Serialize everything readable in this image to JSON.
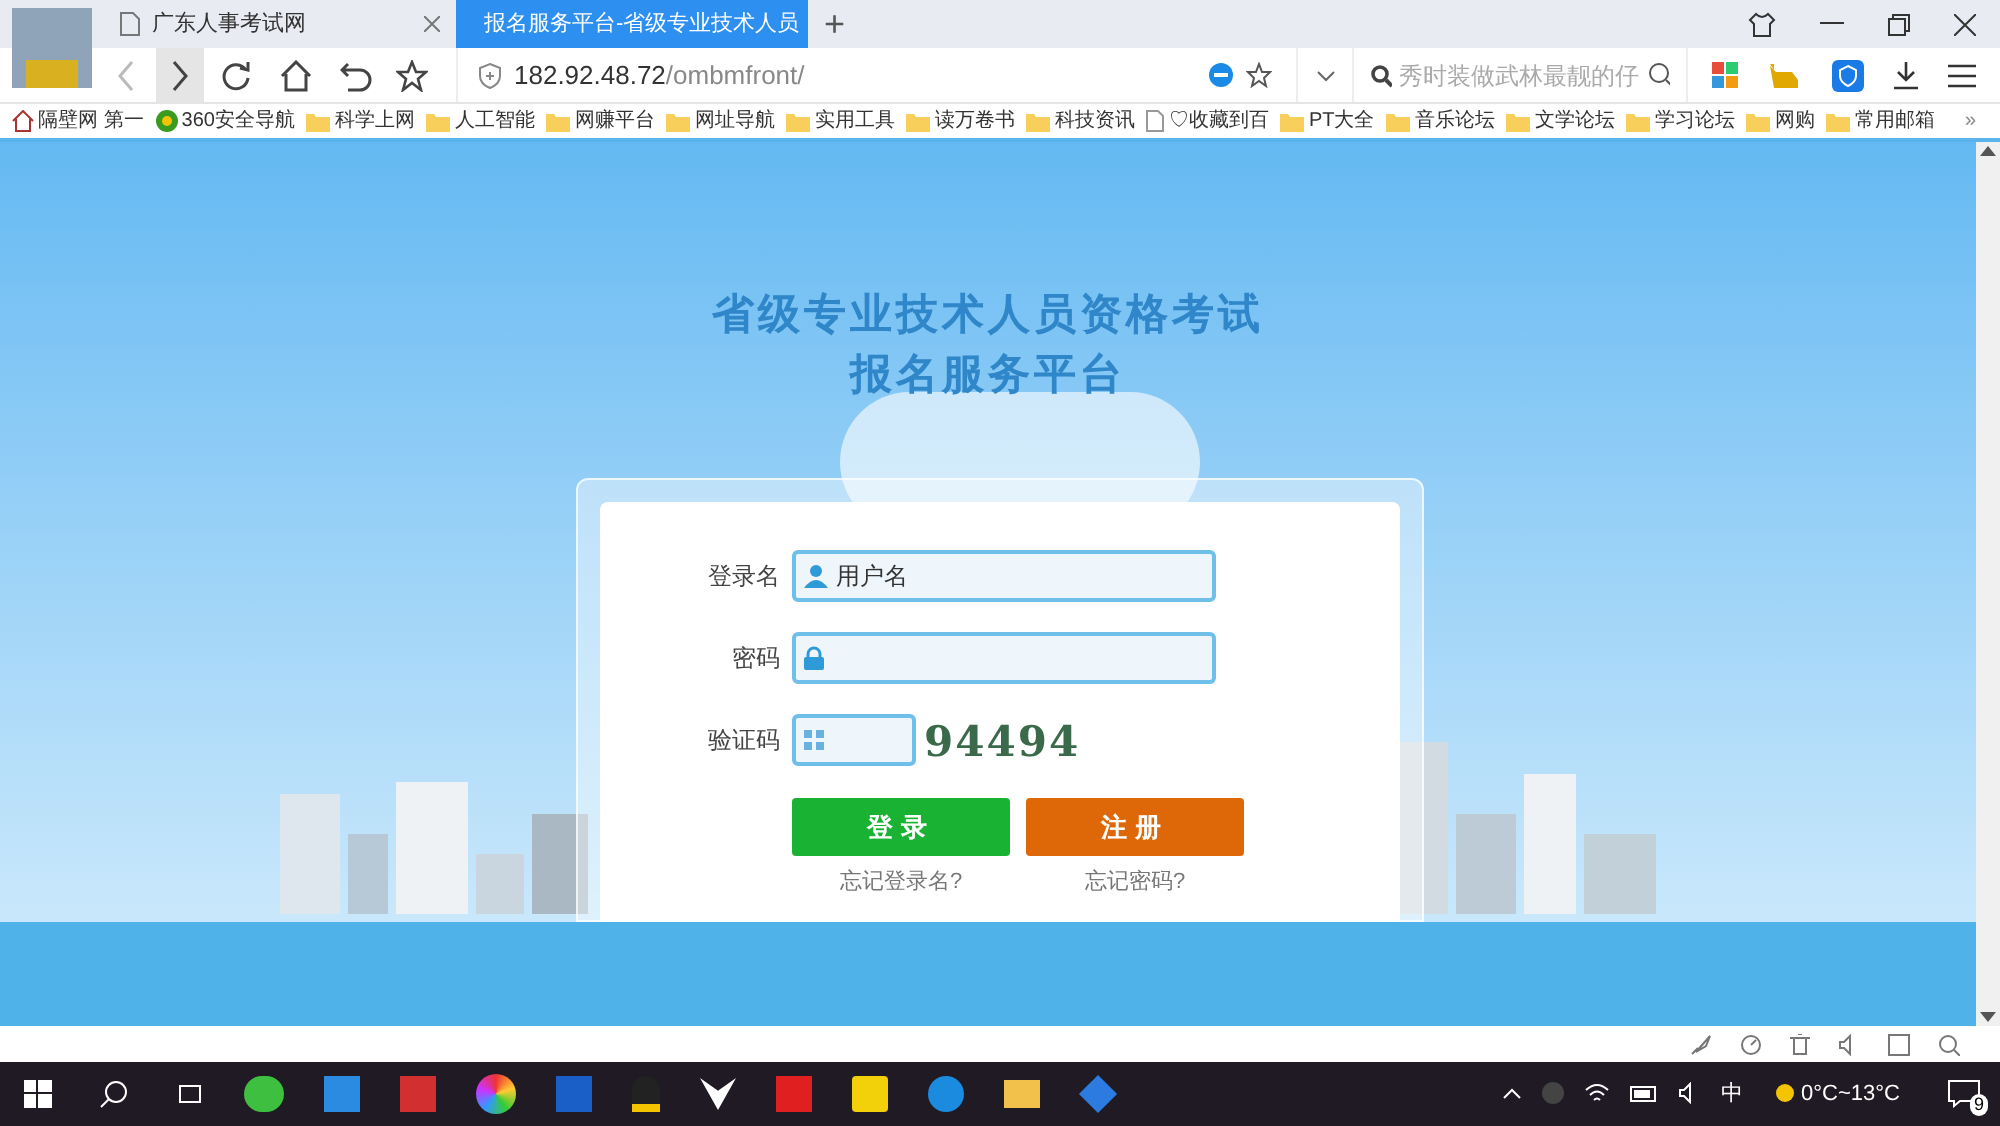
{
  "tabs": [
    {
      "title": "广东人事考试网",
      "selected": false
    },
    {
      "title": "报名服务平台-省级专业技术人员",
      "selected": true
    }
  ],
  "new_tab_button": "+",
  "address_bar": {
    "host": "182.92.48.72",
    "path": "/ombmfront/"
  },
  "search": {
    "placeholder": "秀时装做武林最靓的仔"
  },
  "bookmarks": [
    {
      "label": "隔壁网 第一",
      "kind": "home"
    },
    {
      "label": "360安全导航",
      "kind": "globe"
    },
    {
      "label": "科学上网",
      "kind": "folder"
    },
    {
      "label": "人工智能",
      "kind": "folder"
    },
    {
      "label": "网赚平台",
      "kind": "folder"
    },
    {
      "label": "网址导航",
      "kind": "folder"
    },
    {
      "label": "实用工具",
      "kind": "folder"
    },
    {
      "label": "读万卷书",
      "kind": "folder"
    },
    {
      "label": "科技资讯",
      "kind": "folder"
    },
    {
      "label": "♡收藏到百",
      "kind": "page"
    },
    {
      "label": "PT大全",
      "kind": "folder"
    },
    {
      "label": "音乐论坛",
      "kind": "folder"
    },
    {
      "label": "文学论坛",
      "kind": "folder"
    },
    {
      "label": "学习论坛",
      "kind": "folder"
    },
    {
      "label": "网购",
      "kind": "folder"
    },
    {
      "label": "常用邮箱",
      "kind": "folder"
    }
  ],
  "bookmarks_more": "»",
  "page": {
    "title_line_1": "省级专业技术人员资格考试",
    "title_line_2": "报名服务平台",
    "login": {
      "username_label": "登录名",
      "username_placeholder": "用户名",
      "password_label": "密码",
      "captcha_label": "验证码",
      "captcha_code": "94494",
      "login_button": "登录",
      "register_button": "注册",
      "forgot_username": "忘记登录名?",
      "forgot_password": "忘记密码?"
    }
  },
  "taskbar": {
    "ime": "中",
    "weather": "0°C~13°C",
    "notifications": "9"
  }
}
